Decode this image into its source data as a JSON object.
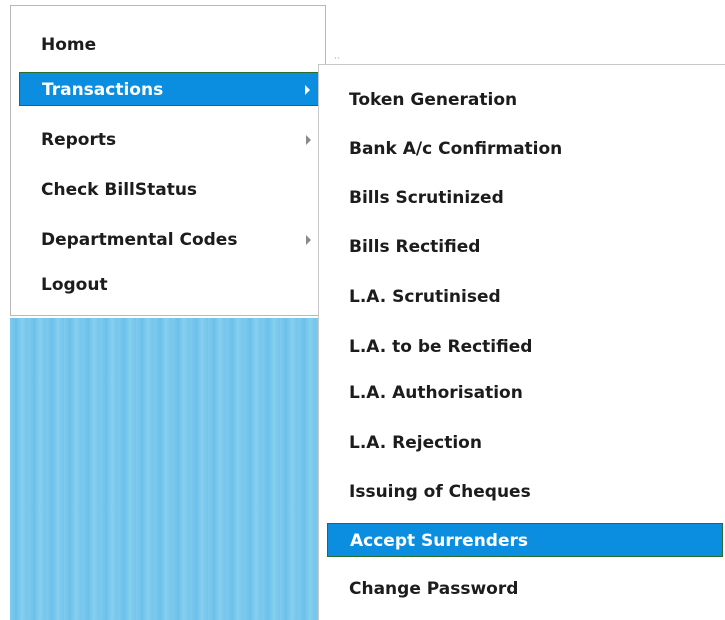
{
  "menu": {
    "items": [
      {
        "label": "Home",
        "has_submenu": false,
        "selected": false
      },
      {
        "label": "Transactions",
        "has_submenu": true,
        "selected": true
      },
      {
        "label": "Reports",
        "has_submenu": true,
        "selected": false
      },
      {
        "label": "Check BillStatus",
        "has_submenu": false,
        "selected": false
      },
      {
        "label": "Departmental Codes",
        "has_submenu": true,
        "selected": false
      },
      {
        "label": "Logout",
        "has_submenu": false,
        "selected": false
      }
    ]
  },
  "submenu": {
    "parent": "Transactions",
    "items": [
      {
        "label": "Token Generation",
        "selected": false
      },
      {
        "label": "Bank A/c Confirmation",
        "selected": false
      },
      {
        "label": "Bills Scrutinized",
        "selected": false
      },
      {
        "label": "Bills Rectified",
        "selected": false
      },
      {
        "label": "L.A. Scrutinised",
        "selected": false
      },
      {
        "label": "L.A. to be Rectified",
        "selected": false
      },
      {
        "label": "L.A. Authorisation",
        "selected": false
      },
      {
        "label": "L.A. Rejection",
        "selected": false
      },
      {
        "label": "Issuing of Cheques",
        "selected": false
      },
      {
        "label": "Accept Surrenders",
        "selected": true
      },
      {
        "label": "Change Password",
        "selected": false
      }
    ]
  },
  "colors": {
    "highlight": "#0b8ee0",
    "highlight_border": "#2b6e2b",
    "text": "#1c1c1c",
    "background_panel": "#7fcbee"
  },
  "icons": {
    "submenu_arrow": "chevron-right-icon"
  }
}
